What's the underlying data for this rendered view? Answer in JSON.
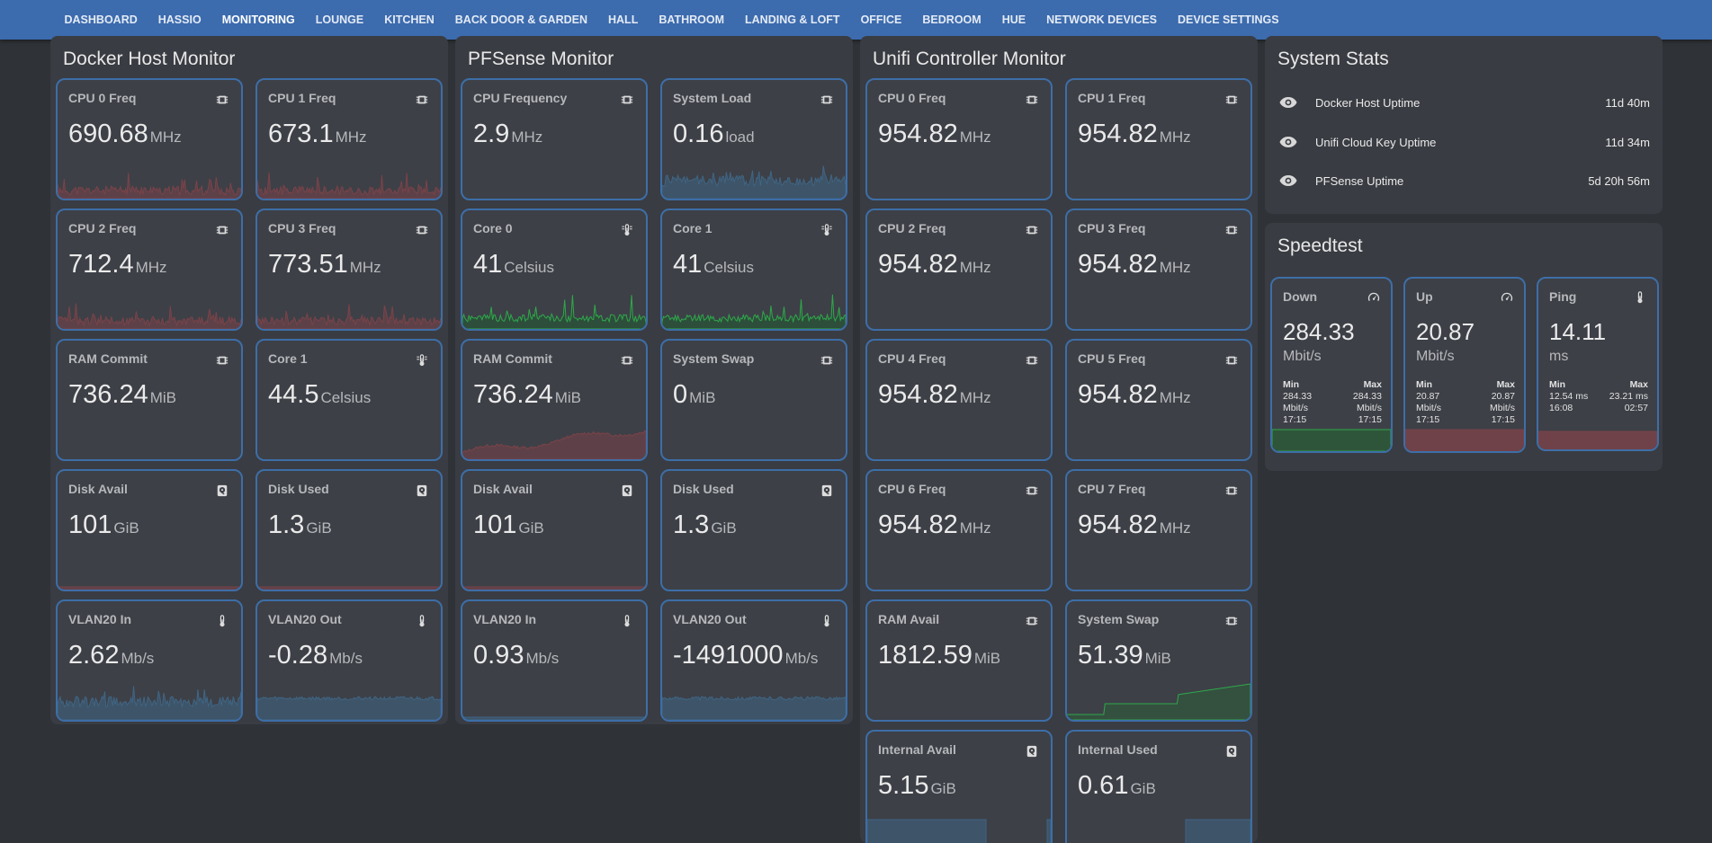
{
  "nav": {
    "tabs": [
      "DASHBOARD",
      "HASSIO",
      "MONITORING",
      "LOUNGE",
      "KITCHEN",
      "BACK DOOR & GARDEN",
      "HALL",
      "BATHROOM",
      "LANDING & LOFT",
      "OFFICE",
      "BEDROOM",
      "HUE",
      "NETWORK DEVICES",
      "DEVICE SETTINGS"
    ],
    "active": "MONITORING"
  },
  "docker": {
    "title": "Docker Host Monitor",
    "cards": [
      {
        "name": "CPU 0 Freq",
        "value": "690.68",
        "unit": "MHz",
        "icon": "chip-icon"
      },
      {
        "name": "CPU 1 Freq",
        "value": "673.1",
        "unit": "MHz",
        "icon": "chip-icon"
      },
      {
        "name": "CPU 2 Freq",
        "value": "712.4",
        "unit": "MHz",
        "icon": "chip-icon"
      },
      {
        "name": "CPU 3 Freq",
        "value": "773.51",
        "unit": "MHz",
        "icon": "chip-icon"
      },
      {
        "name": "RAM Commit",
        "value": "736.24",
        "unit": "MiB",
        "icon": "chip-icon"
      },
      {
        "name": "Core 1",
        "value": "44.5",
        "unit": "Celsius",
        "icon": "thermometer-icon"
      },
      {
        "name": "Disk Avail",
        "value": "101",
        "unit": "GiB",
        "icon": "harddisk-icon"
      },
      {
        "name": "Disk Used",
        "value": "1.3",
        "unit": "GiB",
        "icon": "harddisk-icon"
      },
      {
        "name": "VLAN20 In",
        "value": "2.62",
        "unit": "Mb/s",
        "icon": "thermometer-small-icon"
      },
      {
        "name": "VLAN20 Out",
        "value": "-0.28",
        "unit": "Mb/s",
        "icon": "thermometer-small-icon"
      }
    ]
  },
  "pfsense": {
    "title": "PFSense Monitor",
    "cards": [
      {
        "name": "CPU Frequency",
        "value": "2.9",
        "unit": "MHz",
        "icon": "chip-icon"
      },
      {
        "name": "System Load",
        "value": "0.16",
        "unit": "load",
        "icon": "chip-icon"
      },
      {
        "name": "Core 0",
        "value": "41",
        "unit": "Celsius",
        "icon": "thermometer-icon"
      },
      {
        "name": "Core 1",
        "value": "41",
        "unit": "Celsius",
        "icon": "thermometer-icon"
      },
      {
        "name": "RAM Commit",
        "value": "736.24",
        "unit": "MiB",
        "icon": "chip-icon"
      },
      {
        "name": "System Swap",
        "value": "0",
        "unit": "MiB",
        "icon": "chip-icon"
      },
      {
        "name": "Disk Avail",
        "value": "101",
        "unit": "GiB",
        "icon": "harddisk-icon"
      },
      {
        "name": "Disk Used",
        "value": "1.3",
        "unit": "GiB",
        "icon": "harddisk-icon"
      },
      {
        "name": "VLAN20 In",
        "value": "0.93",
        "unit": "Mb/s",
        "icon": "thermometer-small-icon"
      },
      {
        "name": "VLAN20 Out",
        "value": "-1491000",
        "unit": "Mb/s",
        "icon": "thermometer-small-icon"
      }
    ]
  },
  "unifi": {
    "title": "Unifi Controller Monitor",
    "cards": [
      {
        "name": "CPU 0 Freq",
        "value": "954.82",
        "unit": "MHz",
        "icon": "chip-icon"
      },
      {
        "name": "CPU 1 Freq",
        "value": "954.82",
        "unit": "MHz",
        "icon": "chip-icon"
      },
      {
        "name": "CPU 2 Freq",
        "value": "954.82",
        "unit": "MHz",
        "icon": "chip-icon"
      },
      {
        "name": "CPU 3 Freq",
        "value": "954.82",
        "unit": "MHz",
        "icon": "chip-icon"
      },
      {
        "name": "CPU 4 Freq",
        "value": "954.82",
        "unit": "MHz",
        "icon": "chip-icon"
      },
      {
        "name": "CPU 5 Freq",
        "value": "954.82",
        "unit": "MHz",
        "icon": "chip-icon"
      },
      {
        "name": "CPU 6 Freq",
        "value": "954.82",
        "unit": "MHz",
        "icon": "chip-icon"
      },
      {
        "name": "CPU 7 Freq",
        "value": "954.82",
        "unit": "MHz",
        "icon": "chip-icon"
      },
      {
        "name": "RAM Avail",
        "value": "1812.59",
        "unit": "MiB",
        "icon": "chip-icon"
      },
      {
        "name": "System Swap",
        "value": "51.39",
        "unit": "MiB",
        "icon": "chip-icon"
      },
      {
        "name": "Internal Avail",
        "value": "5.15",
        "unit": "GiB",
        "icon": "harddisk-icon"
      },
      {
        "name": "Internal Used",
        "value": "0.61",
        "unit": "GiB",
        "icon": "harddisk-icon"
      }
    ]
  },
  "system_stats": {
    "title": "System Stats",
    "rows": [
      {
        "label": "Docker Host Uptime",
        "value": "11d 40m"
      },
      {
        "label": "Unifi Cloud Key Uptime",
        "value": "11d 34m"
      },
      {
        "label": "PFSense Uptime",
        "value": "5d 20h 56m"
      }
    ]
  },
  "speedtest": {
    "title": "Speedtest",
    "min_label": "Min",
    "max_label": "Max",
    "cards": [
      {
        "name": "Down",
        "value": "284.33",
        "unit": "Mbit/s",
        "icon": "speedometer-icon",
        "min": [
          "284.33",
          "Mbit/s",
          "17:15"
        ],
        "max": [
          "284.33",
          "Mbit/s",
          "17:15"
        ]
      },
      {
        "name": "Up",
        "value": "20.87",
        "unit": "Mbit/s",
        "icon": "speedometer-icon",
        "min": [
          "20.87",
          "Mbit/s",
          "17:15"
        ],
        "max": [
          "20.87",
          "Mbit/s",
          "17:15"
        ]
      },
      {
        "name": "Ping",
        "value": "14.11",
        "unit": "ms",
        "icon": "thermometer-small-icon",
        "min": [
          "12.54 ms",
          "16:08"
        ],
        "max": [
          "23.21 ms",
          "02:57"
        ]
      }
    ]
  },
  "colors": {
    "nav": "#3c6bae",
    "card_border": "#3d6ea8",
    "spark_red": "#7a4248",
    "spark_blue": "#3f6584",
    "spark_green": "#2fa84a"
  }
}
